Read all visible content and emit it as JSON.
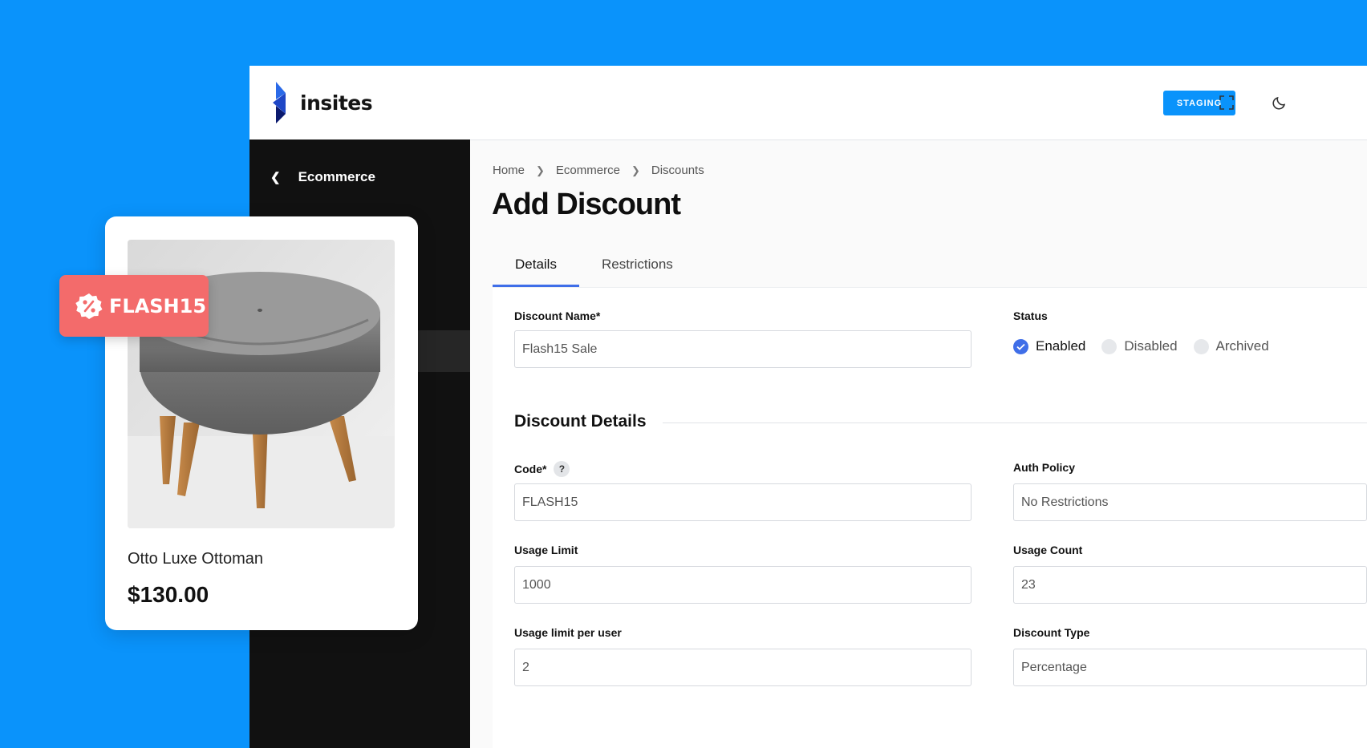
{
  "brand": {
    "name": "insites"
  },
  "header": {
    "environment_label": "STAGING",
    "fullscreen_icon": "expand-icon",
    "theme_icon": "moon-icon"
  },
  "sidebar": {
    "back_label": "Ecommerce",
    "back_icon": "chevron-left-icon"
  },
  "breadcrumb": [
    "Home",
    "Ecommerce",
    "Discounts"
  ],
  "page": {
    "title": "Add Discount"
  },
  "tabs": [
    {
      "label": "Details",
      "active": true
    },
    {
      "label": "Restrictions",
      "active": false
    }
  ],
  "form": {
    "discount_name": {
      "label": "Discount Name*",
      "value": "Flash15 Sale"
    },
    "status": {
      "label": "Status",
      "options": [
        "Enabled",
        "Disabled",
        "Archived"
      ],
      "selected": "Enabled"
    },
    "section_title": "Discount Details",
    "code": {
      "label": "Code*",
      "value": "FLASH15",
      "help": "?"
    },
    "auth_policy": {
      "label": "Auth Policy",
      "value": "No Restrictions"
    },
    "usage_limit": {
      "label": "Usage Limit",
      "value": "1000"
    },
    "usage_count": {
      "label": "Usage Count",
      "value": "23"
    },
    "usage_limit_per_user": {
      "label": "Usage limit per user",
      "value": "2"
    },
    "discount_type": {
      "label": "Discount Type",
      "value": "Percentage"
    }
  },
  "product_card": {
    "name": "Otto Luxe Ottoman",
    "price": "$130.00"
  },
  "coupon": {
    "code": "FLASH15",
    "icon": "percent-badge-icon"
  },
  "colors": {
    "background": "#0a93fb",
    "accent": "#3f6ee8",
    "coupon": "#f36b6b",
    "sidebar": "#111111"
  }
}
